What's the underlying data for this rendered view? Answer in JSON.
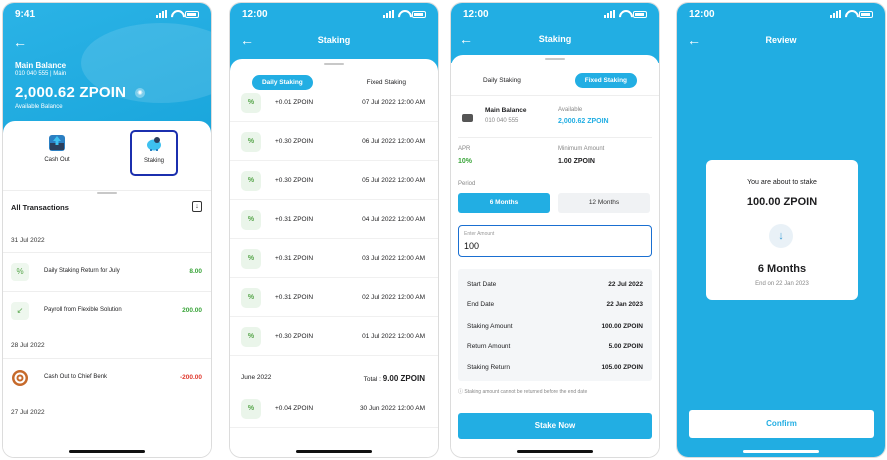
{
  "status_time_1": "9:41",
  "status_time_2": "12:00",
  "status_time_3": "12:00",
  "status_time_4": "12:00",
  "screen1": {
    "balance_title": "Main Balance",
    "account_line": "010 040 555 | Main",
    "balance_amount": "2,000.62 ZPOIN",
    "balance_sub": "Available Balance",
    "action_cashout": "Cash Out",
    "action_staking": "Staking",
    "all_tx": "All Transactions",
    "groups": [
      {
        "date": "31 Jul 2022",
        "items": [
          {
            "label": "Daily Staking Return for July",
            "amount": "8.00",
            "kind": "pos",
            "icon": "percent-icon"
          },
          {
            "label": "Payroll from Flexible Solution",
            "amount": "200.00",
            "kind": "pos",
            "icon": "arrow-in-icon"
          }
        ]
      },
      {
        "date": "28 Jul 2022",
        "items": [
          {
            "label": "Cash Out to Chief Benk",
            "amount": "-200.00",
            "kind": "neg",
            "icon": "bank-logo-icon"
          }
        ]
      },
      {
        "date": "27 Jul 2022",
        "items": []
      }
    ]
  },
  "screen2": {
    "title": "Staking",
    "tab_daily": "Daily Staking",
    "tab_fixed": "Fixed Staking",
    "rows": [
      {
        "amount": "+0.01 ZPOIN",
        "date": "07 Jul 2022 12:00 AM"
      },
      {
        "amount": "+0.30 ZPOIN",
        "date": "06 Jul 2022 12:00 AM"
      },
      {
        "amount": "+0.30 ZPOIN",
        "date": "05 Jul 2022 12:00 AM"
      },
      {
        "amount": "+0.31 ZPOIN",
        "date": "04 Jul 2022 12:00 AM"
      },
      {
        "amount": "+0.31 ZPOIN",
        "date": "03 Jul 2022 12:00 AM"
      },
      {
        "amount": "+0.31 ZPOIN",
        "date": "02 Jul 2022 12:00 AM"
      },
      {
        "amount": "+0.30 ZPOIN",
        "date": "01 Jul 2022 12:00 AM"
      }
    ],
    "month_label": "June 2022",
    "month_total_label": "Total :",
    "month_total_value": "9.00 ZPOIN",
    "june_row": {
      "amount": "+0.04 ZPOIN",
      "date": "30 Jun 2022 12:00 AM"
    }
  },
  "screen3": {
    "title": "Staking",
    "tab_daily": "Daily Staking",
    "tab_fixed": "Fixed Staking",
    "wallet_title": "Main Balance",
    "wallet_number": "010 040 555",
    "available_label": "Available",
    "available_value": "2,000.62 ZPOIN",
    "apr_label": "APR",
    "apr_value": "10%",
    "min_label": "Minimum Amount",
    "min_value": "1.00 ZPOIN",
    "period_label": "Period",
    "period_6": "6 Months",
    "period_12": "12 Months",
    "amount_label": "Enter Amount",
    "amount_value": "100",
    "summary": [
      {
        "k": "Start Date",
        "v": "22 Jul 2022"
      },
      {
        "k": "End Date",
        "v": "22 Jan 2023"
      },
      {
        "k": "Staking Amount",
        "v": "100.00 ZPOIN"
      },
      {
        "k": "Return Amount",
        "v": "5.00 ZPOIN"
      },
      {
        "k": "Staking Return",
        "v": "105.00 ZPOIN"
      }
    ],
    "note": "Staking amount cannot be returned before the end date",
    "button": "Stake Now"
  },
  "screen4": {
    "title": "Review",
    "about": "You are about to stake",
    "amount": "100.00 ZPOIN",
    "duration": "6 Months",
    "end": "End on 22 Jan 2023",
    "button": "Confirm"
  },
  "colors": {
    "brand": "#22aee3",
    "positive": "#3aa53a",
    "negative": "#e0392e"
  }
}
